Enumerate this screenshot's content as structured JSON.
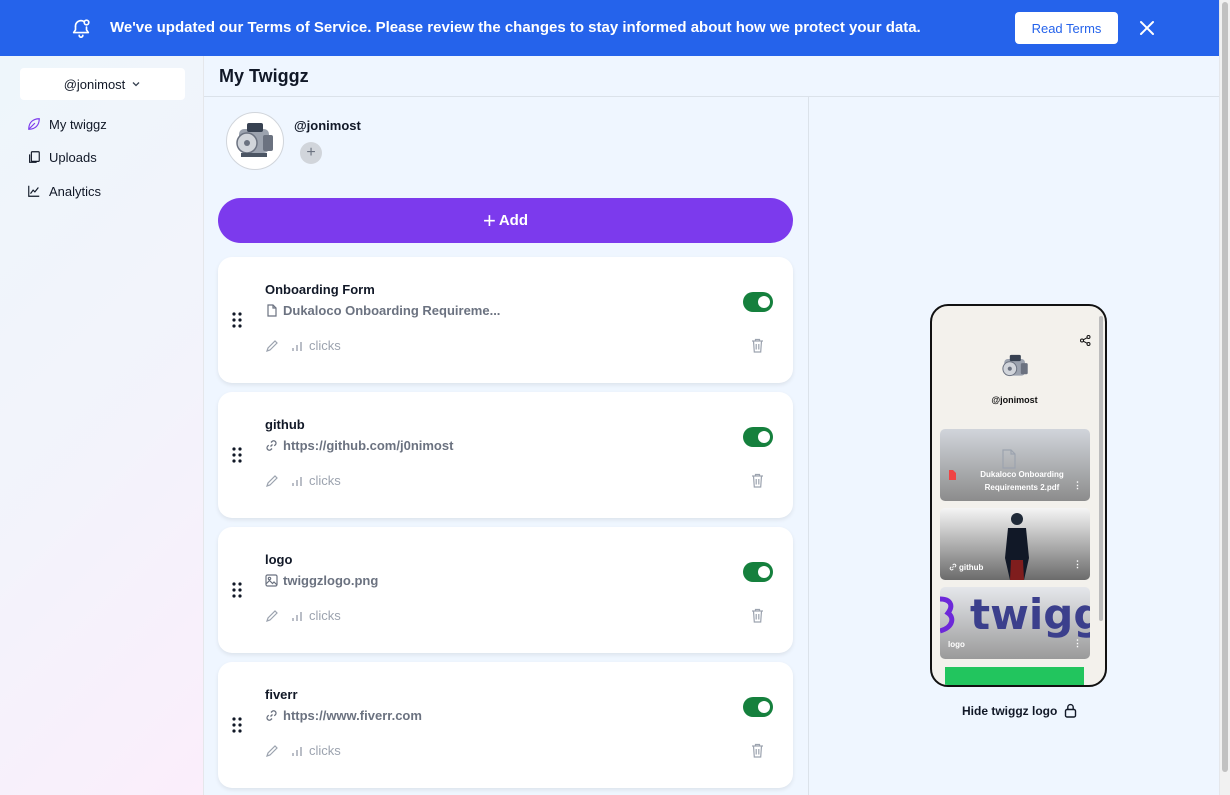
{
  "banner": {
    "message": "We've updated our Terms of Service. Please review the changes to stay informed about how we protect your data.",
    "read_terms_label": "Read Terms",
    "bell_icon": "bell-icon",
    "close_icon": "close-icon",
    "bg_color": "#2563eb"
  },
  "sidebar": {
    "account": "@jonimost",
    "items": [
      {
        "label": "My twiggz",
        "icon": "leaf-icon"
      },
      {
        "label": "Uploads",
        "icon": "files-icon"
      },
      {
        "label": "Analytics",
        "icon": "chart-line-icon"
      }
    ]
  },
  "main": {
    "title": "My Twiggz",
    "profile": {
      "username": "@jonimost",
      "add_label": "+"
    },
    "add_button": {
      "label": "Add"
    },
    "links": [
      {
        "title": "Onboarding Form",
        "subtitle": "Dukaloco Onboarding Requireme...",
        "subtitle_icon": "file-icon",
        "clicks_label": "clicks",
        "enabled": true
      },
      {
        "title": "github",
        "subtitle": "https://github.com/j0nimost",
        "subtitle_icon": "link-icon",
        "clicks_label": "clicks",
        "enabled": true
      },
      {
        "title": "logo",
        "subtitle": "twiggzlogo.png",
        "subtitle_icon": "image-icon",
        "clicks_label": "clicks",
        "enabled": true
      },
      {
        "title": "fiverr",
        "subtitle": "https://www.fiverr.com",
        "subtitle_icon": "link-icon",
        "clicks_label": "clicks",
        "enabled": true
      }
    ]
  },
  "preview": {
    "username": "@jonimost",
    "cards": [
      {
        "title": "Dukaloco Onboarding Requirements 2.pdf"
      },
      {
        "title": "github"
      },
      {
        "title": "logo",
        "logo_text": "twigg"
      }
    ],
    "hide_logo_label": "Hide twiggz logo"
  },
  "colors": {
    "accent": "#7c3aed",
    "toggle_on": "#15803d",
    "background": "#eff6ff"
  }
}
